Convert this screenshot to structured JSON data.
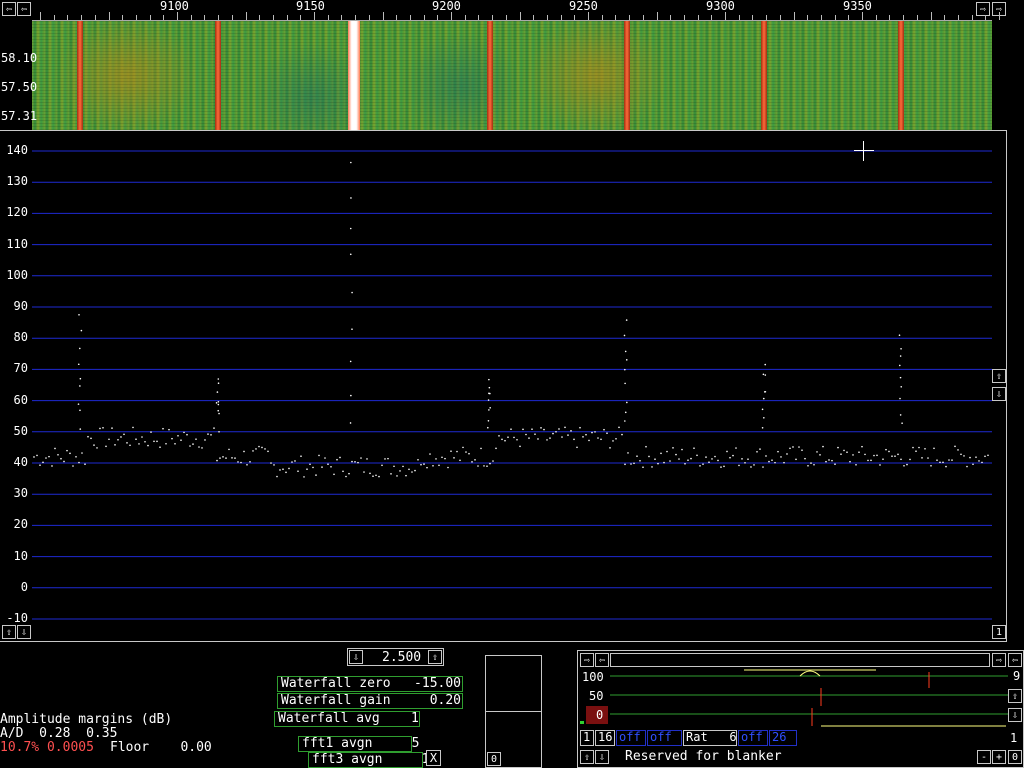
{
  "frequency_axis": {
    "labels": [
      "9100",
      "9150",
      "9200",
      "9250",
      "9300",
      "9350"
    ]
  },
  "waterfall": {
    "scale_labels": [
      "58.10",
      "57.50",
      "57.31"
    ]
  },
  "spectrum": {
    "y_labels": [
      "140",
      "130",
      "120",
      "110",
      "100",
      "90",
      "80",
      "70",
      "60",
      "50",
      "40",
      "30",
      "20",
      "10",
      "0",
      "-10"
    ]
  },
  "nav_icons": {
    "left": "arrow-left-icon",
    "right": "arrow-right-icon",
    "up": "arrow-up-icon",
    "down": "arrow-down-icon"
  },
  "controls": {
    "zoom_value": "2.500",
    "waterfall_zero": "Waterfall zero   -15.00",
    "waterfall_gain": "Waterfall gain     0.20",
    "waterfall_avg": "Waterfall avg    1",
    "fft1_avgn": "fft1 avgn     5",
    "fft3_avgn": "fft3 avgn     1",
    "close_label": "X",
    "one_label": "1",
    "small_zero": "0"
  },
  "amplitude": {
    "title": "Amplitude margins (dB)",
    "ad_line": "A/D  0.28  0.35",
    "status_red": "10.7% 0.0005",
    "floor_line": "Floor    0.00"
  },
  "blanker": {
    "y_100": "100",
    "y_50": "50",
    "y_0": "0",
    "right_9": "9",
    "right_1": "1",
    "btn_1": "1",
    "btn_16": "16",
    "off1": "off",
    "off2": "off",
    "rat": "Rat   6",
    "off3": "off",
    "val_26": "26",
    "reserved": "Reserved for blanker",
    "minus": "-",
    "plus": "+",
    "zero": "0"
  },
  "colors": {
    "grid_blue": "#1e2ad2",
    "box_green": "#2f9e2f",
    "status_red": "#ff5050",
    "marker_red": "#ff3b1e"
  }
}
